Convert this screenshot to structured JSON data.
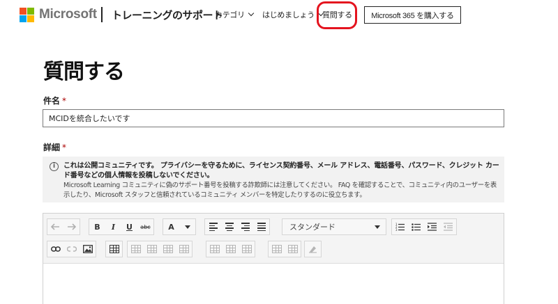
{
  "header": {
    "logo_text": "Microsoft",
    "logo_colors": [
      "#f25022",
      "#7fba00",
      "#00a4ef",
      "#ffb900"
    ],
    "site_title": "トレーニングのサポート",
    "nav": [
      {
        "label": "カテゴリ",
        "has_dropdown": true
      },
      {
        "label": "はじめましょう",
        "has_dropdown": true
      },
      {
        "label": "質問する",
        "has_dropdown": false,
        "highlighted": true
      }
    ],
    "highlight_color": "#e4131e",
    "buy_button": "Microsoft 365 を購入する"
  },
  "main": {
    "page_title": "質問する",
    "subject": {
      "label": "件名",
      "required_mark": "*",
      "value": "MCIDを統合したいです"
    },
    "details": {
      "label": "詳細",
      "required_mark": "*"
    },
    "notice": {
      "icon": "info-icon",
      "bold_text": "これは公開コミュニティです。 プライバシーを守るために、ライセンス契約番号、メール アドレス、電話番号、パスワード、クレジット カード番号などの個人情報を投稿しないでください。",
      "body_text": "Microsoft Learning コミュニティに偽のサポート番号を投稿する詐欺師には注意してください。 FAQ を確認することで、コミュニティ内のユーザーを表示したり、Microsoft スタッフと信頼されているコミュニティ メンバーを特定したりするのに役立ちます。"
    },
    "editor": {
      "toolbar": {
        "undo_icon": "undo-icon",
        "redo_icon": "redo-icon",
        "bold": "B",
        "italic": "I",
        "underline": "U",
        "strikethrough": "abc",
        "font_color": "A",
        "font_style_selected": "スタンダード"
      }
    }
  }
}
